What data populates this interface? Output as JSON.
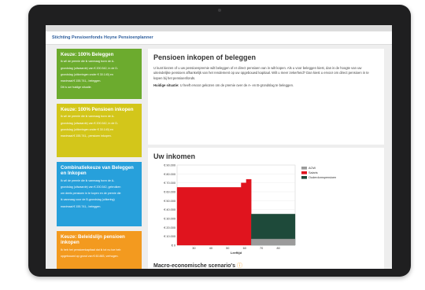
{
  "header": {
    "title": "Stichting Pensioenfonds Hoyne Pensioenplanner"
  },
  "cards": [
    {
      "title": "Keuze: 100% Beleggen",
      "lines": [
        "Ik wil de premie die ik vanmaag bovn de A-",
        "grondslag (uitwaarde) van € 200.542, in de D-",
        "grondslag (uitkeringen onder € 30.140) en",
        "maximaal € 155.741,- beleggen.",
        "",
        "Dit is uw huidige situatie."
      ]
    },
    {
      "title": "Keuze: 100% Pensioen inkopen",
      "lines": [
        "Ik wil de premie die ik vanmaag bovn de A-",
        "grondslag (uitwaarde) van € 200.542, in de D-",
        "grondslag (uitkeringen onder € 30.140) en",
        "maximaal € 155.741,- pensioen inkopen."
      ]
    },
    {
      "title": "Combinatiekeuze van Beleggen en Inkopen",
      "lines": [
        "Ik wil de premie die ik vanmaag bovn de A-",
        "grondslag (uitwaarde) van € 200.542, gebruiken",
        "om deels pensioen in te kopen en de premie die",
        "ik vanmaag voor de B-grondslag (uitkering)",
        "maximaal € 155.741,- beleggen."
      ]
    },
    {
      "title": "Keuze: Beleidslijn pensioen inkopen",
      "lines": [
        "Ik heb het pensioenkapitaal dat ik tot nu toe heb",
        "opgebouwd op grond van € 60.883, verhogen."
      ]
    }
  ],
  "intro": {
    "title": "Pensioen inkopen of beleggen",
    "paragraphs": [
      "U kunt kiezen of u uw pensioenpremie wilt beleggen of er direct pensioen van in wilt kopen. Als u voor beleggen kiest, dan is de hoogte van uw uiteindelijke pensioen afhankelijk van het rendement op uw opgebouwd kapitaal. Wilt u meer zekerheid? Dan kiest u ervoor om direct pensioen in te kopen bij het pensioenfonds."
    ],
    "status_label": "Huidige situatie:",
    "status_text": "U heeft ervoor gekozen om de premie over de A- en B-grondslag te beleggen."
  },
  "income": {
    "title": "Uw inkomen",
    "macro_title": "Macro-economische scenario's",
    "macro_icon": "question-circle-icon"
  },
  "chart_data": {
    "type": "area",
    "xlabel": "Leeftijd",
    "x_ticks": [
      "20",
      "30",
      "40",
      "50",
      "60",
      "70",
      "80",
      "90"
    ],
    "y_ticks": [
      "€ 90.000",
      "€ 80.000",
      "€ 70.000",
      "€ 60.000",
      "€ 50.000",
      "€ 40.000",
      "€ 30.000",
      "€ 20.000",
      "€ 10.000",
      "€ 0"
    ],
    "ylim": [
      0,
      90000
    ],
    "xlim": [
      20,
      90
    ],
    "legend": [
      {
        "name": "AOW",
        "color": "#9b9b9b"
      },
      {
        "name": "Salaris",
        "color": "#e0141e"
      },
      {
        "name": "Ouderdomspensioen",
        "color": "#1e4a3a"
      }
    ],
    "series": [
      {
        "name": "Salaris",
        "x": [
          20,
          58,
          58,
          61,
          61,
          64
        ],
        "y": [
          65000,
          65000,
          70000,
          70000,
          74000,
          74000
        ],
        "color": "#e0141e"
      },
      {
        "name": "Ouderdomspensioen",
        "x": [
          64,
          90
        ],
        "y": [
          35000,
          35000
        ],
        "color": "#1e4a3a"
      },
      {
        "name": "AOW",
        "x": [
          64,
          90
        ],
        "y": [
          7000,
          7000
        ],
        "color": "#9b9b9b"
      }
    ]
  }
}
